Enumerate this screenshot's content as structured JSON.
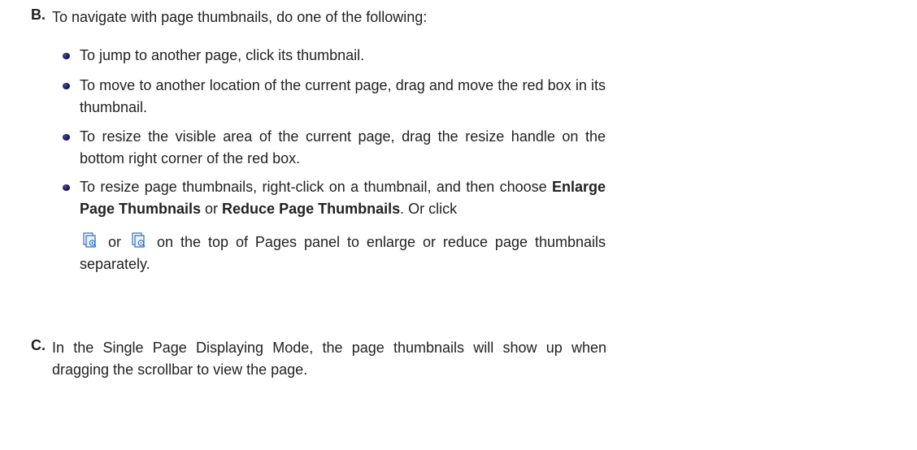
{
  "section_b": {
    "marker": "B.",
    "text": "To navigate with page thumbnails, do one of the following:"
  },
  "bullets": {
    "jump": "To jump to another page, click its thumbnail.",
    "move": "To move to another location of the current page, drag and move the red box in its thumbnail.",
    "resize_area": "To resize the visible area of the current page, drag the resize handle on the bottom right corner of the red box.",
    "resize_thumbs": {
      "part1": "To resize page thumbnails, right-click on a thumbnail, and then choose ",
      "bold1": "Enlarge Page Thumbnails",
      "part2": " or ",
      "bold2": "Reduce Page Thumbnails",
      "part3": ". Or click",
      "part4": "or",
      "part5": "on the top of Pages panel to enlarge or reduce page thumbnails separately.",
      "enlarge_icon": "enlarge-thumbnails-icon",
      "reduce_icon": "reduce-thumbnails-icon"
    }
  },
  "section_c": {
    "marker": "C.",
    "text": "In the Single Page Displaying Mode, the page thumbnails will show up when dragging the scrollbar to view the page."
  },
  "colors": {
    "text": "#222222",
    "bullet": "#14145a",
    "icon_blue": "#2a6cc4"
  }
}
